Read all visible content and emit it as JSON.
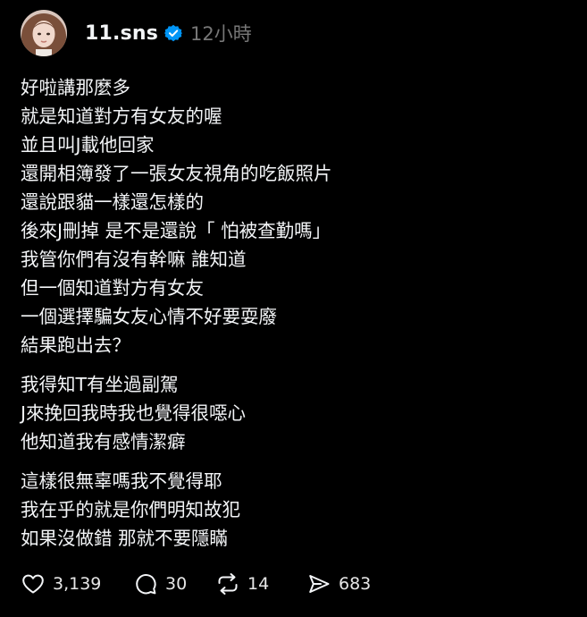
{
  "post": {
    "username": "11.sns",
    "time": "12小時",
    "paragraphs": [
      [
        "好啦講那麼多",
        "就是知道對方有女友的喔",
        "並且叫J載他回家",
        "還開相簿發了一張女友視角的吃飯照片",
        "還說跟貓一樣還怎樣的",
        "後來J刪掉 是不是還說「 怕被查勤嗎」",
        "我管你們有沒有幹嘛 誰知道",
        "但一個知道對方有女友",
        "一個選擇騙女友心情不好要耍廢",
        "結果跑出去？"
      ],
      [
        "我得知T有坐過副駕",
        "J來挽回我時我也覺得很噁心",
        "他知道我有感情潔癖"
      ],
      [
        "這樣很無辜嗎我不覺得耶",
        "我在乎的就是你們明知故犯",
        "如果沒做錯 那就不要隱瞞"
      ]
    ]
  },
  "actions": {
    "like_count": "3,139",
    "reply_count": "30",
    "repost_count": "14",
    "share_count": "683"
  },
  "icons": {
    "verified": "verified-badge-icon",
    "like": "heart-icon",
    "reply": "comment-bubble-icon",
    "repost": "repost-arrows-icon",
    "share": "send-icon"
  },
  "colors": {
    "background": "#000000",
    "text": "#f3f5f7",
    "muted": "#777777",
    "verified": "#0095f6"
  }
}
